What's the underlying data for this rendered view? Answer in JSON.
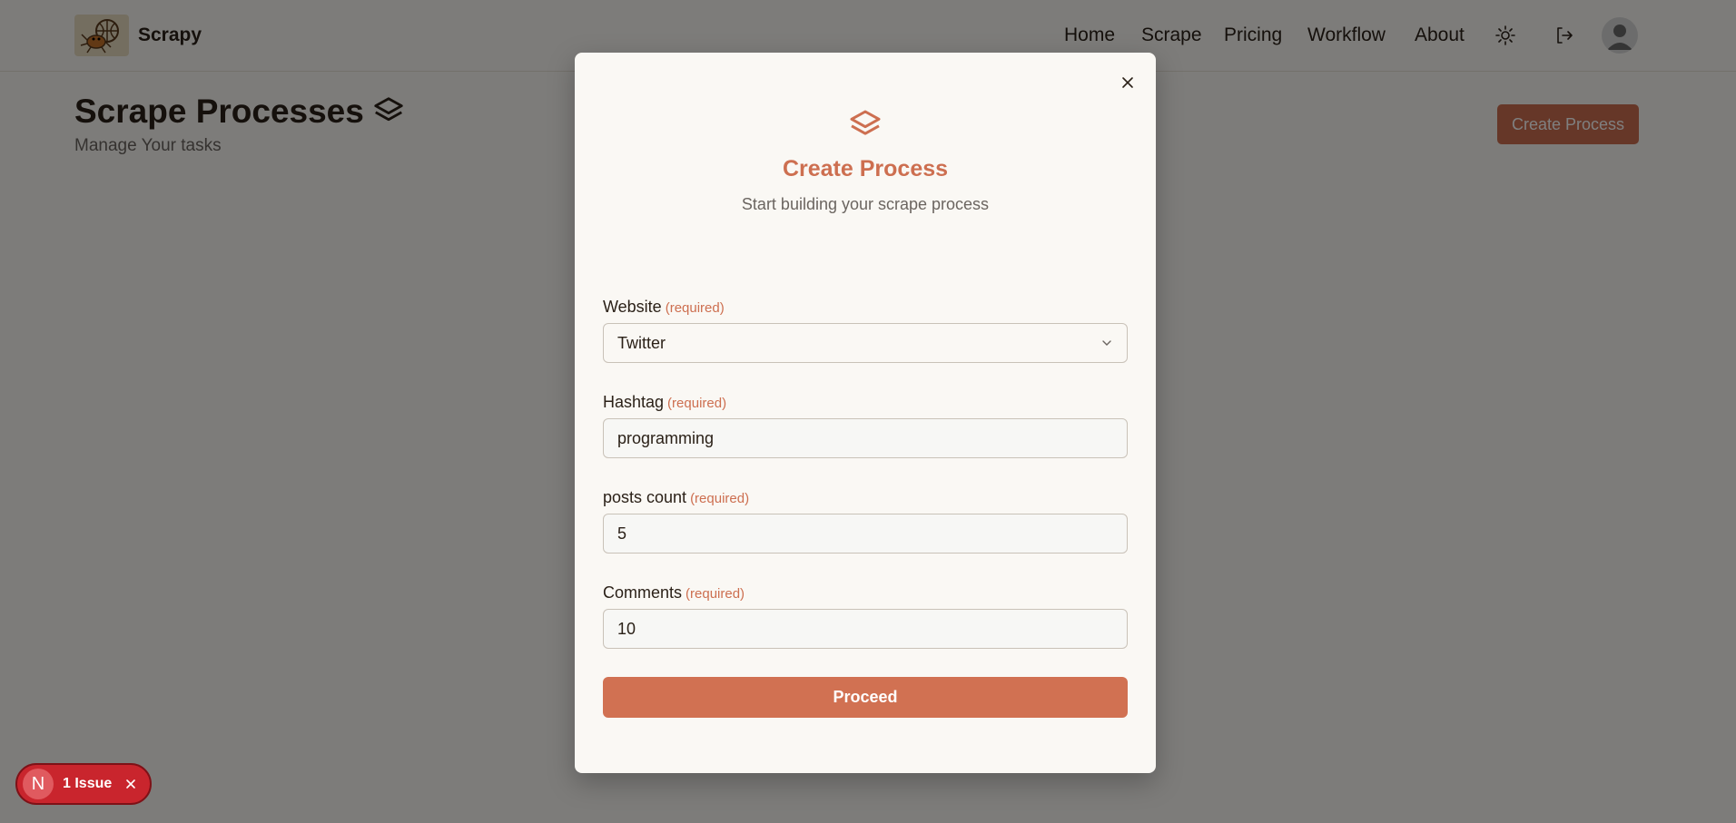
{
  "navbar": {
    "brand": "Scrapy",
    "links": [
      "Home",
      "Scrape",
      "Pricing",
      "Workflow",
      "About"
    ],
    "icons": [
      "sun-icon",
      "logout-icon",
      "user-avatar-icon"
    ]
  },
  "page": {
    "title": "Scrape Processes",
    "subtitle": "Manage Your tasks",
    "create_button": "Create Process"
  },
  "modal": {
    "title": "Create Process",
    "subtitle": "Start building your scrape process",
    "required_tag": "(required)",
    "fields": {
      "website": {
        "label": "Website",
        "value": "Twitter"
      },
      "hashtag": {
        "label": "Hashtag",
        "value": "programming"
      },
      "posts_count": {
        "label": "posts count",
        "value": "5"
      },
      "comments": {
        "label": "Comments",
        "value": "10"
      }
    },
    "proceed_button": "Proceed"
  },
  "issue_badge": {
    "letter": "N",
    "text": "1 Issue"
  },
  "colors": {
    "accent": "#cd6f50",
    "overlay": "rgba(0,0,0,0.5)",
    "issue": "#c9252d"
  }
}
